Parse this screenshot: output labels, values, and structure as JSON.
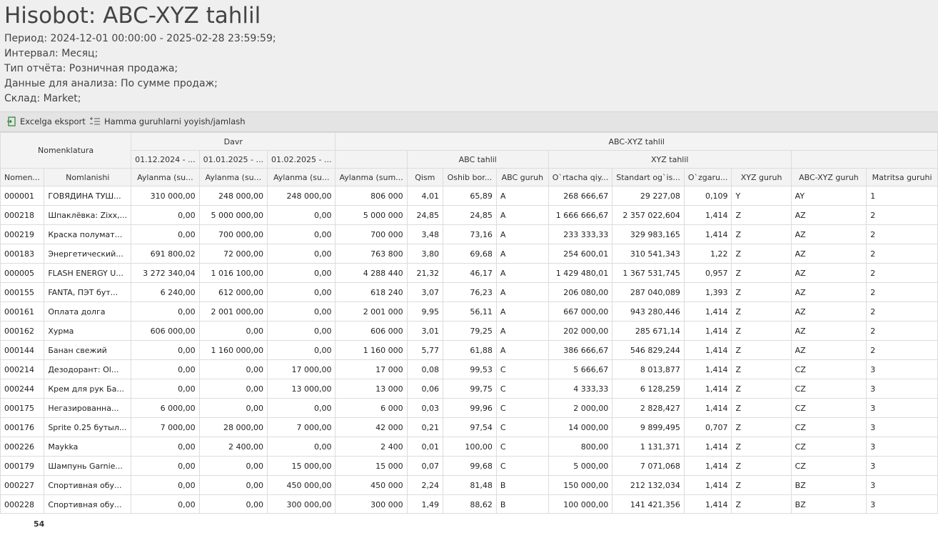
{
  "report": {
    "title": "Hisobot: ABC-XYZ tahlil",
    "lines": [
      "Период: 2024-12-01 00:00:00 - 2025-02-28 23:59:59;",
      "Интервал: Месяц;",
      "Тип отчёта: Розничная продажа;",
      "Данные для анализа: По сумме продаж;",
      "Склад: Market;"
    ]
  },
  "toolbar": {
    "excel_label": "Excelga eksport",
    "expand_label": "Hamma guruhlarni yoyish/jamlash",
    "excel_icon": "excel-export-icon",
    "expand_icon": "expand-collapse-icon"
  },
  "headers": {
    "nomenklatura": "Nomenklatura",
    "davr": "Davr",
    "abcxyz": "ABC-XYZ tahlil",
    "abc": "ABC tahlil",
    "xyz": "XYZ tahlil",
    "periods": [
      "01.12.2024 - ...",
      "01.01.2025 - ...",
      "01.02.2025 - ..."
    ],
    "columns": [
      "Nomen...",
      "Nomlanishi",
      "Aylanma (su...",
      "Aylanma (su...",
      "Aylanma (su...",
      "Aylanma (sum...",
      "Qism",
      "Oshib bor...",
      "ABC guruh",
      "O`rtacha qiy...",
      "Standart og`is...",
      "O`zgaru...",
      "XYZ guruh",
      "ABC-XYZ guruh",
      "Matritsa guruhi"
    ]
  },
  "rows": [
    [
      "000001",
      "ГОВЯДИНА ТУШ...",
      "310 000,00",
      "248 000,00",
      "248 000,00",
      "806 000",
      "4,01",
      "65,89",
      "A",
      "268 666,67",
      "29 227,08",
      "0,109",
      "Y",
      "AY",
      "1"
    ],
    [
      "000218",
      "Шпаклёвка: Zixx,...",
      "0,00",
      "5 000 000,00",
      "0,00",
      "5 000 000",
      "24,85",
      "24,85",
      "A",
      "1 666 666,67",
      "2 357 022,604",
      "1,414",
      "Z",
      "AZ",
      "2"
    ],
    [
      "000219",
      "Краска полумат...",
      "0,00",
      "700 000,00",
      "0,00",
      "700 000",
      "3,48",
      "73,16",
      "A",
      "233 333,33",
      "329 983,165",
      "1,414",
      "Z",
      "AZ",
      "2"
    ],
    [
      "000183",
      "Энергетический...",
      "691 800,02",
      "72 000,00",
      "0,00",
      "763 800",
      "3,80",
      "69,68",
      "A",
      "254 600,01",
      "310 541,343",
      "1,22",
      "Z",
      "AZ",
      "2"
    ],
    [
      "000005",
      "FLASH ENERGY U...",
      "3 272 340,04",
      "1 016 100,00",
      "0,00",
      "4 288 440",
      "21,32",
      "46,17",
      "A",
      "1 429 480,01",
      "1 367 531,745",
      "0,957",
      "Z",
      "AZ",
      "2"
    ],
    [
      "000155",
      "FANTA, ПЭТ бут...",
      "6 240,00",
      "612 000,00",
      "0,00",
      "618 240",
      "3,07",
      "76,23",
      "A",
      "206 080,00",
      "287 040,089",
      "1,393",
      "Z",
      "AZ",
      "2"
    ],
    [
      "000161",
      "Оплата долга",
      "0,00",
      "2 001 000,00",
      "0,00",
      "2 001 000",
      "9,95",
      "56,11",
      "A",
      "667 000,00",
      "943 280,446",
      "1,414",
      "Z",
      "AZ",
      "2"
    ],
    [
      "000162",
      "Хурма",
      "606 000,00",
      "0,00",
      "0,00",
      "606 000",
      "3,01",
      "79,25",
      "A",
      "202 000,00",
      "285 671,14",
      "1,414",
      "Z",
      "AZ",
      "2"
    ],
    [
      "000144",
      "Банан свежий",
      "0,00",
      "1 160 000,00",
      "0,00",
      "1 160 000",
      "5,77",
      "61,88",
      "A",
      "386 666,67",
      "546 829,244",
      "1,414",
      "Z",
      "AZ",
      "2"
    ],
    [
      "000214",
      "Дезодорант: Ol...",
      "0,00",
      "0,00",
      "17 000,00",
      "17 000",
      "0,08",
      "99,53",
      "C",
      "5 666,67",
      "8 013,877",
      "1,414",
      "Z",
      "CZ",
      "3"
    ],
    [
      "000244",
      "Крем для рук Ба...",
      "0,00",
      "0,00",
      "13 000,00",
      "13 000",
      "0,06",
      "99,75",
      "C",
      "4 333,33",
      "6 128,259",
      "1,414",
      "Z",
      "CZ",
      "3"
    ],
    [
      "000175",
      "Негазированна...",
      "6 000,00",
      "0,00",
      "0,00",
      "6 000",
      "0,03",
      "99,96",
      "C",
      "2 000,00",
      "2 828,427",
      "1,414",
      "Z",
      "CZ",
      "3"
    ],
    [
      "000176",
      "Sprite 0.25 бутыл...",
      "7 000,00",
      "28 000,00",
      "7 000,00",
      "42 000",
      "0,21",
      "97,54",
      "C",
      "14 000,00",
      "9 899,495",
      "0,707",
      "Z",
      "CZ",
      "3"
    ],
    [
      "000226",
      "Maykka",
      "0,00",
      "2 400,00",
      "0,00",
      "2 400",
      "0,01",
      "100,00",
      "C",
      "800,00",
      "1 131,371",
      "1,414",
      "Z",
      "CZ",
      "3"
    ],
    [
      "000179",
      "Шампунь Garnie...",
      "0,00",
      "0,00",
      "15 000,00",
      "15 000",
      "0,07",
      "99,68",
      "C",
      "5 000,00",
      "7 071,068",
      "1,414",
      "Z",
      "CZ",
      "3"
    ],
    [
      "000227",
      "Спортивная обу...",
      "0,00",
      "0,00",
      "450 000,00",
      "450 000",
      "2,24",
      "81,48",
      "B",
      "150 000,00",
      "212 132,034",
      "1,414",
      "Z",
      "BZ",
      "3"
    ],
    [
      "000228",
      "Спортивная обу...",
      "0,00",
      "0,00",
      "300 000,00",
      "300 000",
      "1,49",
      "88,62",
      "B",
      "100 000,00",
      "141 421,356",
      "1,414",
      "Z",
      "BZ",
      "3"
    ]
  ],
  "footer": {
    "count": "54"
  }
}
